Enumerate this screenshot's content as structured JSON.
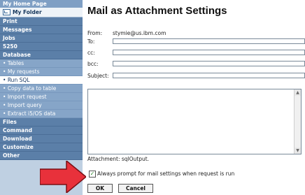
{
  "sidebar": {
    "home": "My Home Page",
    "folder": "My Folder",
    "sections": [
      "Print",
      "Messages",
      "Jobs",
      "5250",
      "Database"
    ],
    "database_items": [
      "Tables",
      "My requests",
      "Run SQL",
      "Copy data to table",
      "Import request",
      "Import query",
      "Extract i5/OS data"
    ],
    "bottom_sections": [
      "Files",
      "Command",
      "Download",
      "Customize",
      "Other"
    ]
  },
  "main": {
    "title": "Mail as Attachment Settings",
    "from_label": "From:",
    "from_value": "stymie@us.ibm.com",
    "to_label": "To:",
    "cc_label": "cc:",
    "bcc_label": "bcc:",
    "subject_label": "Subject:",
    "attachment": "Attachment: sqlOutput.",
    "checkbox_label": "Always prompt for mail settings when request is run",
    "checkbox_checked": true,
    "ok_label": "OK",
    "cancel_label": "Cancel"
  },
  "colors": {
    "arrow": "#e8313b",
    "sidebar_dark": "#5b7fa8",
    "sidebar_light": "#86a5c8"
  },
  "icons": {
    "folder": "folder-icon",
    "arrow": "red-arrow-icon",
    "check": "check-icon"
  }
}
